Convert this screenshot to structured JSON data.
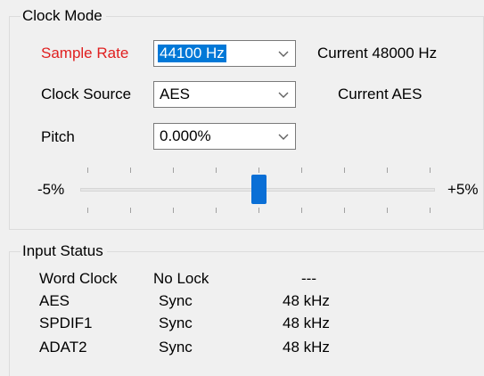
{
  "clock_mode": {
    "title": "Clock Mode",
    "sample_rate": {
      "label": "Sample Rate",
      "value": "44100 Hz",
      "current": "Current  48000 Hz"
    },
    "clock_source": {
      "label": "Clock Source",
      "value": "AES",
      "current": "Current  AES"
    },
    "pitch": {
      "label": "Pitch",
      "value": "0.000%"
    },
    "slider": {
      "min_label": "-5%",
      "max_label": "+5%",
      "value_percent": 0.0
    }
  },
  "input_status": {
    "title": "Input Status",
    "rows": [
      {
        "name": "Word Clock",
        "status": "No Lock",
        "rate": "---"
      },
      {
        "name": "AES",
        "status": "Sync",
        "rate": "48 kHz"
      },
      {
        "name": "SPDIF1",
        "status": "Sync",
        "rate": "48 kHz"
      },
      {
        "name": "ADAT2",
        "status": "Sync",
        "rate": "48 kHz"
      }
    ]
  },
  "colors": {
    "sample_rate_label": "#e02020",
    "selection": "#0078d7",
    "slider_thumb": "#0a6fd6"
  }
}
